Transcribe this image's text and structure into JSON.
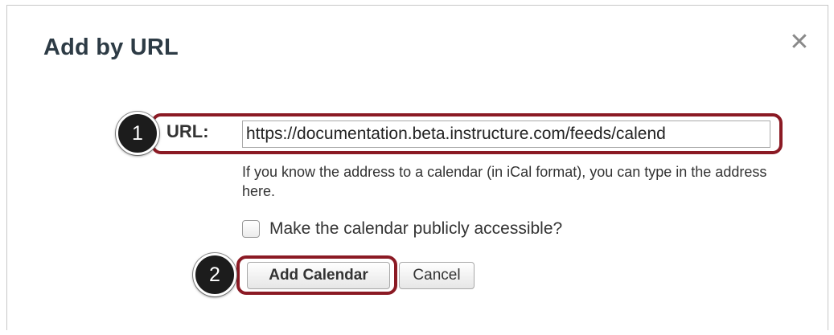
{
  "dialog": {
    "title": "Add by URL",
    "close_symbol": "✕"
  },
  "callouts": {
    "step1": "1",
    "step2": "2"
  },
  "form": {
    "url_label": "URL:",
    "url_value": "https://documentation.beta.instructure.com/feeds/calend",
    "help_text": "If you know the address to a calendar (in iCal format), you can type in the address here.",
    "public_checkbox_label": "Make the calendar publicly accessible?",
    "public_checked": false,
    "add_button_label": "Add Calendar",
    "cancel_button_label": "Cancel"
  },
  "colors": {
    "highlight": "#8b1a24",
    "badge": "#1c1c1c",
    "title": "#2d3b45"
  },
  "icons": {
    "close": "close-icon",
    "checkbox": "checkbox-icon"
  }
}
